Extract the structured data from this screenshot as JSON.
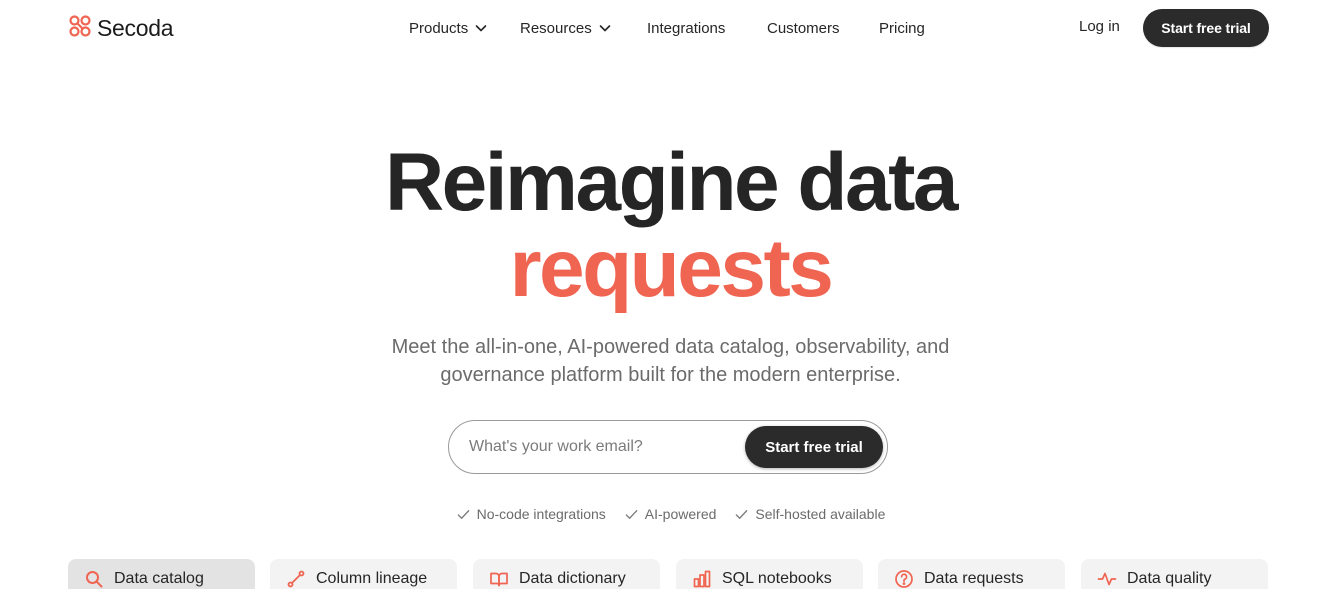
{
  "brand": {
    "name": "Secoda",
    "accent": "#f06452",
    "dark": "#2b2b2b"
  },
  "nav": {
    "items": [
      {
        "label": "Products",
        "has_dropdown": true
      },
      {
        "label": "Resources",
        "has_dropdown": true
      },
      {
        "label": "Integrations",
        "has_dropdown": false
      },
      {
        "label": "Customers",
        "has_dropdown": false
      },
      {
        "label": "Pricing",
        "has_dropdown": false
      }
    ],
    "login_label": "Log in",
    "cta_label": "Start free trial"
  },
  "hero": {
    "title_line1": "Reimagine data",
    "title_line2": "requests",
    "subtitle_line1": "Meet the all-in-one, AI-powered data catalog, observability, and",
    "subtitle_line2": "governance platform built for the modern enterprise."
  },
  "signup": {
    "email_placeholder": "What's your work email?",
    "email_value": "",
    "cta_label": "Start free trial"
  },
  "features": [
    {
      "label": "No-code integrations",
      "icon": "check-icon"
    },
    {
      "label": "AI-powered",
      "icon": "check-icon"
    },
    {
      "label": "Self-hosted available",
      "icon": "check-icon"
    }
  ],
  "tabs": [
    {
      "label": "Data catalog",
      "icon": "search-icon",
      "active": true
    },
    {
      "label": "Column lineage",
      "icon": "lineage-icon",
      "active": false
    },
    {
      "label": "Data dictionary",
      "icon": "book-icon",
      "active": false
    },
    {
      "label": "SQL notebooks",
      "icon": "bar-chart-icon",
      "active": false
    },
    {
      "label": "Data requests",
      "icon": "question-circle-icon",
      "active": false
    },
    {
      "label": "Data quality",
      "icon": "pulse-icon",
      "active": false
    }
  ]
}
